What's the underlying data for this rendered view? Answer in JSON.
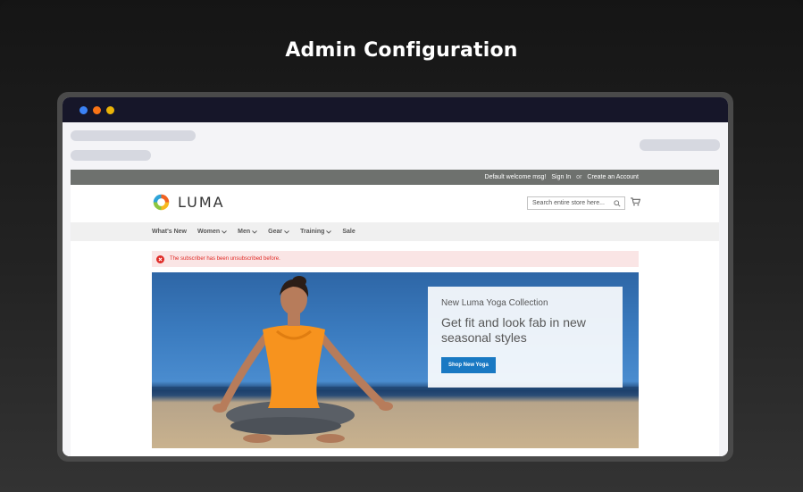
{
  "page": {
    "title": "Admin Configuration"
  },
  "store": {
    "topbar": {
      "welcome": "Default welcome msg!",
      "sign_in": "Sign In",
      "or": "or",
      "create_account": "Create an Account"
    },
    "logo_text": "LUMA",
    "search": {
      "placeholder": "Search entire store here..."
    },
    "nav": [
      {
        "label": "What's New",
        "dropdown": false
      },
      {
        "label": "Women",
        "dropdown": true
      },
      {
        "label": "Men",
        "dropdown": true
      },
      {
        "label": "Gear",
        "dropdown": true
      },
      {
        "label": "Training",
        "dropdown": true
      },
      {
        "label": "Sale",
        "dropdown": false
      }
    ],
    "alert": {
      "message": "The subscriber has been unsubscribed before."
    },
    "promo": {
      "kicker": "New Luma Yoga Collection",
      "headline": "Get fit and look fab in new seasonal styles",
      "button": "Shop New Yoga"
    }
  },
  "colors": {
    "accent": "#1979c3",
    "error": "#e02b27",
    "topbar": "#6e716e"
  }
}
